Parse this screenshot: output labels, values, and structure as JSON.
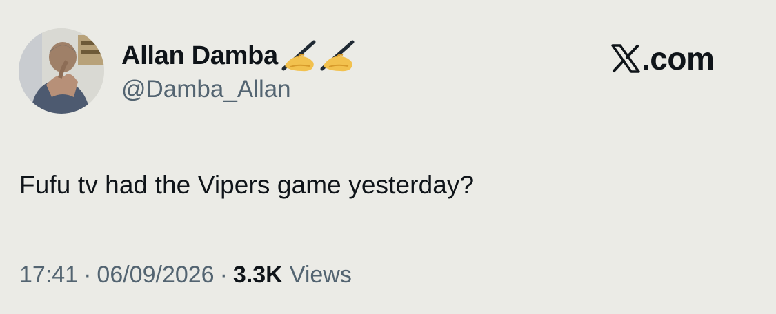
{
  "user": {
    "display_name": "Allan Damba",
    "handle": "@Damba_Allan",
    "avatar_icon": "user-photo",
    "name_emojis": [
      "writing-hand-icon",
      "writing-hand-icon"
    ]
  },
  "brand": {
    "logo_icon": "x-logo-icon",
    "logo_suffix": ".com"
  },
  "tweet": {
    "text": "Fufu tv had the Vipers game yesterday?"
  },
  "meta": {
    "time": "17:41",
    "separator": "·",
    "date": "06/09/2026",
    "views_count": "3.3K",
    "views_label": "Views"
  },
  "colors": {
    "background": "#ebebe6",
    "primary_text": "#0f1419",
    "secondary_text": "#536471"
  }
}
